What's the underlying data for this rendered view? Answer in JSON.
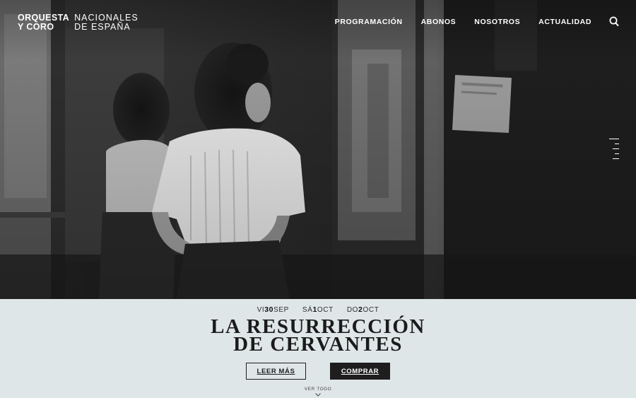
{
  "brand": {
    "bold_line1": "ORQUESTA",
    "bold_line2": "Y CORO",
    "light_line1": "NACIONALES",
    "light_line2": "DE ESPAÑA"
  },
  "nav": {
    "items": [
      "PROGRAMACIÓN",
      "ABONOS",
      "NOSOTROS",
      "ACTUALIDAD"
    ],
    "search_icon": "search-icon",
    "menu_icon": "menu-lines-icon"
  },
  "event": {
    "dates": [
      {
        "day_name": "VI",
        "day_num": "30",
        "month": "SEP"
      },
      {
        "day_name": "SÁ",
        "day_num": "1",
        "month": "OCT"
      },
      {
        "day_name": "DO",
        "day_num": "2",
        "month": "OCT"
      }
    ],
    "title_line1": "LA RESURRECCIÓN",
    "title_line2": "DE CERVANTES",
    "read_more": "LEER MÁS",
    "buy": "COMPRAR",
    "see_all": "VER TODO"
  },
  "colors": {
    "panel_bg": "#dfe6e7",
    "dark_button": "#1e1e1e",
    "hero_bg": "#262626"
  }
}
